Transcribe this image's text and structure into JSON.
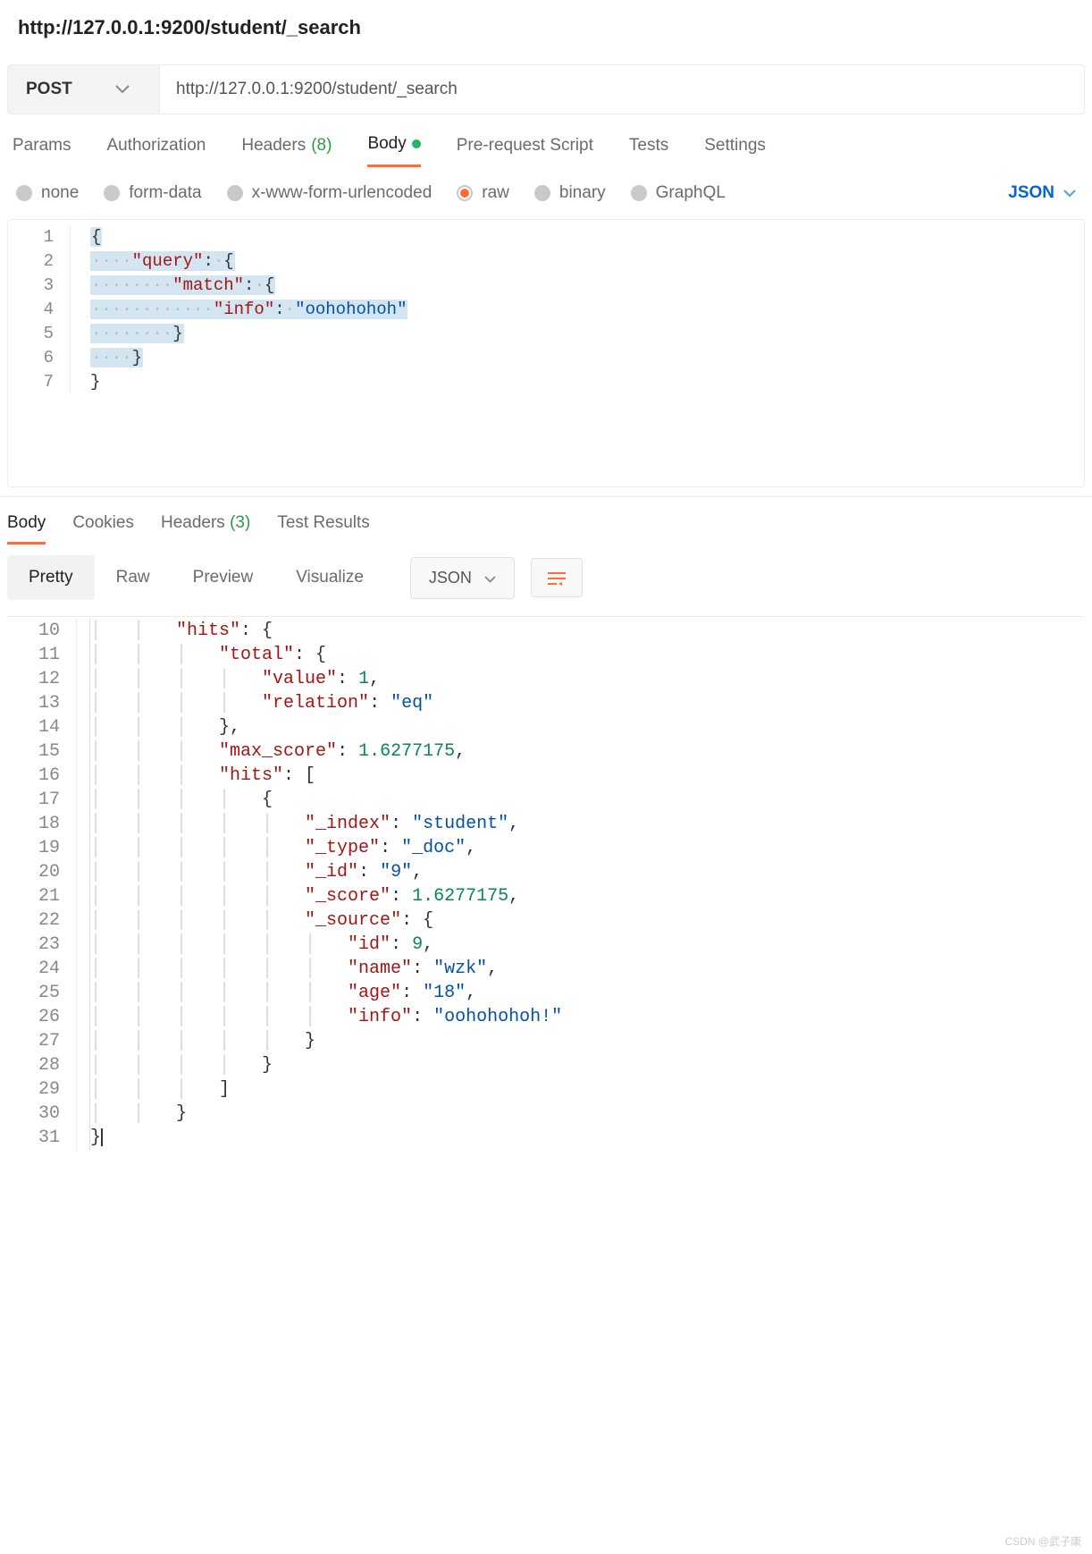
{
  "title": "http://127.0.0.1:9200/student/_search",
  "method": "POST",
  "url": "http://127.0.0.1:9200/student/_search",
  "reqTabs": {
    "params": "Params",
    "authorization": "Authorization",
    "headers": "Headers",
    "headersCount": "(8)",
    "body": "Body",
    "prerequest": "Pre-request Script",
    "tests": "Tests",
    "settings": "Settings"
  },
  "bodyTypes": {
    "none": "none",
    "formData": "form-data",
    "xWwwForm": "x-www-form-urlencoded",
    "raw": "raw",
    "binary": "binary",
    "graphql": "GraphQL",
    "jsonLabel": "JSON"
  },
  "reqBody": {
    "lines": [
      1,
      2,
      3,
      4,
      5,
      6,
      7
    ],
    "l1": "{",
    "l2key": "\"query\"",
    "l3key": "\"match\"",
    "l4key": "\"info\"",
    "l4val": "\"oohohohoh\"",
    "l5": "}",
    "l6": "}",
    "l7": "}"
  },
  "respTabs": {
    "body": "Body",
    "cookies": "Cookies",
    "headers": "Headers",
    "headersCount": "(3)",
    "testResults": "Test Results"
  },
  "formatBtns": {
    "pretty": "Pretty",
    "raw": "Raw",
    "preview": "Preview",
    "visualize": "Visualize",
    "jsonSelect": "JSON"
  },
  "respBody": {
    "startLine": 10,
    "lines": [
      {
        "n": 10,
        "indent": 2,
        "t": "key",
        "k": "\"hits\"",
        "a": ": {"
      },
      {
        "n": 11,
        "indent": 3,
        "t": "key",
        "k": "\"total\"",
        "a": ": {"
      },
      {
        "n": 12,
        "indent": 4,
        "t": "kv-num",
        "k": "\"value\"",
        "v": "1",
        "a": ","
      },
      {
        "n": 13,
        "indent": 4,
        "t": "kv-str",
        "k": "\"relation\"",
        "v": "\"eq\""
      },
      {
        "n": 14,
        "indent": 3,
        "t": "close",
        "a": "},"
      },
      {
        "n": 15,
        "indent": 3,
        "t": "kv-num",
        "k": "\"max_score\"",
        "v": "1.6277175",
        "a": ","
      },
      {
        "n": 16,
        "indent": 3,
        "t": "key",
        "k": "\"hits\"",
        "a": ": ["
      },
      {
        "n": 17,
        "indent": 4,
        "t": "open",
        "a": "{"
      },
      {
        "n": 18,
        "indent": 5,
        "t": "kv-str",
        "k": "\"_index\"",
        "v": "\"student\"",
        "a": ","
      },
      {
        "n": 19,
        "indent": 5,
        "t": "kv-str",
        "k": "\"_type\"",
        "v": "\"_doc\"",
        "a": ","
      },
      {
        "n": 20,
        "indent": 5,
        "t": "kv-str",
        "k": "\"_id\"",
        "v": "\"9\"",
        "a": ","
      },
      {
        "n": 21,
        "indent": 5,
        "t": "kv-num",
        "k": "\"_score\"",
        "v": "1.6277175",
        "a": ","
      },
      {
        "n": 22,
        "indent": 5,
        "t": "key",
        "k": "\"_source\"",
        "a": ": {"
      },
      {
        "n": 23,
        "indent": 6,
        "t": "kv-num",
        "k": "\"id\"",
        "v": "9",
        "a": ","
      },
      {
        "n": 24,
        "indent": 6,
        "t": "kv-str",
        "k": "\"name\"",
        "v": "\"wzk\"",
        "a": ","
      },
      {
        "n": 25,
        "indent": 6,
        "t": "kv-str",
        "k": "\"age\"",
        "v": "\"18\"",
        "a": ","
      },
      {
        "n": 26,
        "indent": 6,
        "t": "kv-str",
        "k": "\"info\"",
        "v": "\"oohohohoh!\""
      },
      {
        "n": 27,
        "indent": 5,
        "t": "close",
        "a": "}"
      },
      {
        "n": 28,
        "indent": 4,
        "t": "close",
        "a": "}"
      },
      {
        "n": 29,
        "indent": 3,
        "t": "close",
        "a": "]"
      },
      {
        "n": 30,
        "indent": 2,
        "t": "close",
        "a": "}"
      },
      {
        "n": 31,
        "indent": 1,
        "t": "lastclose",
        "a": "}"
      }
    ]
  },
  "watermark": "CSDN @武子康"
}
